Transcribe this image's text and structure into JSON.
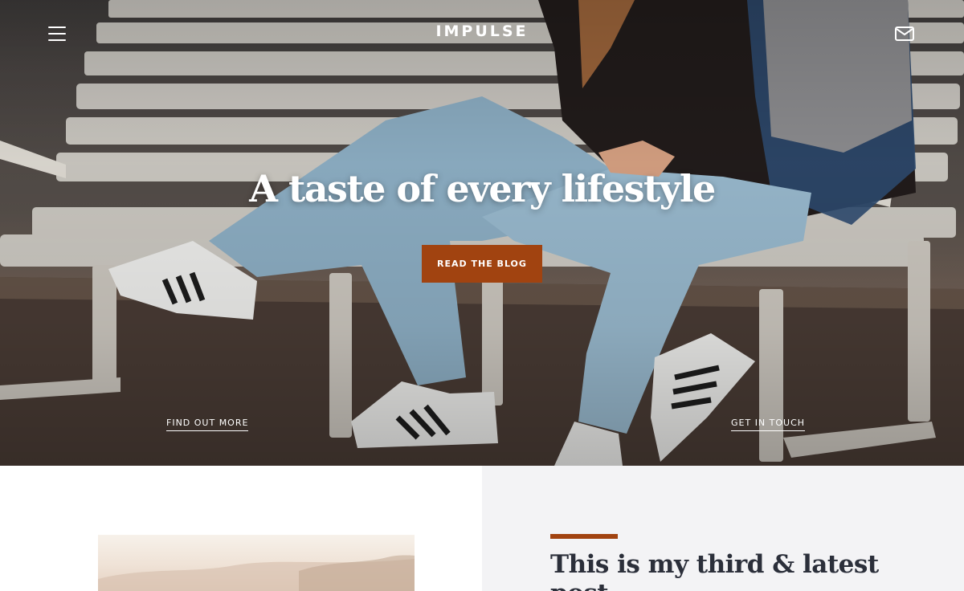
{
  "header": {
    "brand": "IMPULSE",
    "menu_icon": "hamburger-menu-icon",
    "mail_icon": "envelope-icon"
  },
  "hero": {
    "title": "A taste of every lifestyle",
    "cta_label": "READ THE BLOG",
    "link_left": "FIND OUT MORE",
    "link_right": "GET IN TOUCH"
  },
  "latest_post": {
    "title": "This is my third & latest post"
  },
  "colors": {
    "accent": "#a14310",
    "heading_dark": "#2b2f3a",
    "panel_bg": "#f3f3f5"
  }
}
